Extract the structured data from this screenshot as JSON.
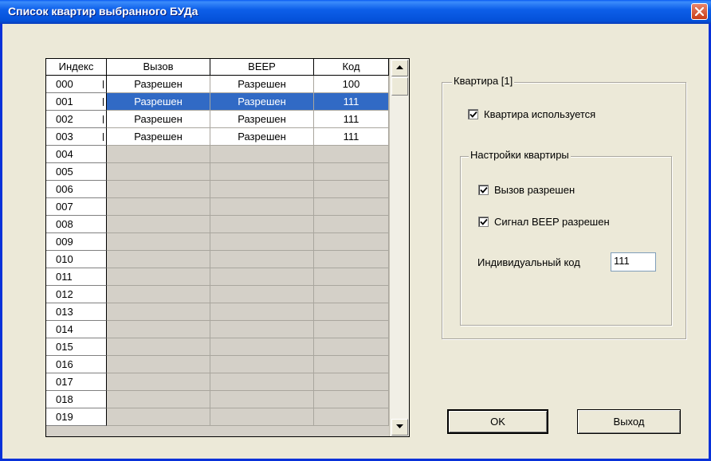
{
  "window": {
    "title": "Список квартир выбранного БУДа"
  },
  "table": {
    "headers": {
      "index": "Индекс",
      "call": "Вызов",
      "beep": "BEEP",
      "code": "Код"
    },
    "rows": [
      {
        "index": "000",
        "call": "Разрешен",
        "beep": "Разрешен",
        "code": "100"
      },
      {
        "index": "001",
        "call": "Разрешен",
        "beep": "Разрешен",
        "code": "111",
        "selected": true
      },
      {
        "index": "002",
        "call": "Разрешен",
        "beep": "Разрешен",
        "code": "111"
      },
      {
        "index": "003",
        "call": "Разрешен",
        "beep": "Разрешен",
        "code": "111"
      },
      {
        "index": "004"
      },
      {
        "index": "005"
      },
      {
        "index": "006"
      },
      {
        "index": "007"
      },
      {
        "index": "008"
      },
      {
        "index": "009"
      },
      {
        "index": "010"
      },
      {
        "index": "011"
      },
      {
        "index": "012"
      },
      {
        "index": "013"
      },
      {
        "index": "014"
      },
      {
        "index": "015"
      },
      {
        "index": "016"
      },
      {
        "index": "017"
      },
      {
        "index": "018"
      },
      {
        "index": "019"
      }
    ]
  },
  "apartment": {
    "group_title": "Квартира [1]",
    "in_use_label": "Квартира используется",
    "in_use_checked": true,
    "settings": {
      "group_title": "Настройки квартиры",
      "call_allowed_label": "Вызов разрешен",
      "call_allowed_checked": true,
      "beep_allowed_label": "Сигнал BEEP разрешен",
      "beep_allowed_checked": true,
      "code_label": "Индивидуальный код",
      "code_value": "111"
    }
  },
  "buttons": {
    "ok": "OK",
    "exit": "Выход"
  },
  "colors": {
    "selection": "#316ac5",
    "titlebar": "#0450d8",
    "dialog_bg": "#ece9d8"
  }
}
